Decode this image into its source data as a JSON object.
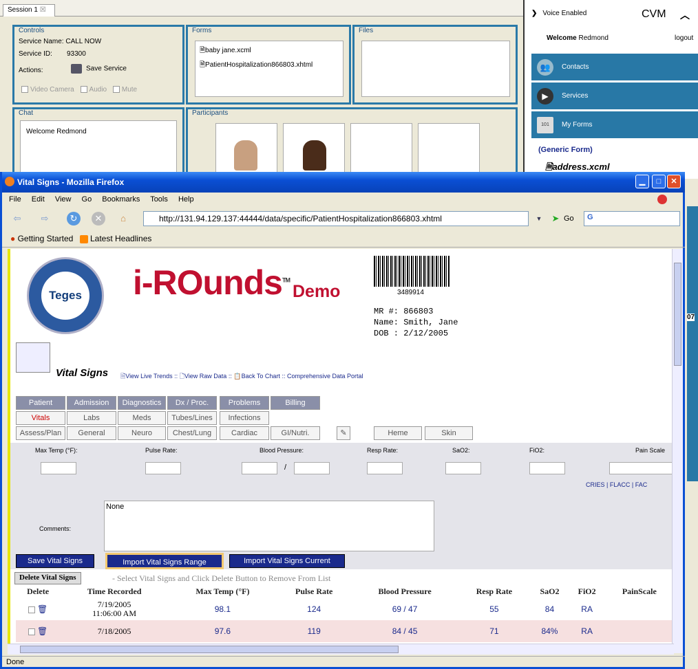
{
  "session": {
    "tab": "Session 1",
    "controls_title": "Controls",
    "service_name": "Service Name:  CALL NOW",
    "service_id_label": "Service ID:",
    "service_id": "93300",
    "actions_label": "Actions:",
    "save_service": "Save Service",
    "video_camera": "Video Camera",
    "audio": "Audio",
    "mute": "Mute",
    "forms_title": "Forms",
    "forms": [
      "baby jane.xcml",
      "PatientHospitalization866803.xhtml"
    ],
    "files_title": "Files",
    "chat_title": "Chat",
    "chat_text": "Welcome Redmond",
    "participants_title": "Participants"
  },
  "right": {
    "voice": "Voice Enabled",
    "cvm": "CVM",
    "welcome": "Welcome",
    "user": "Redmond",
    "logout": "logout",
    "contacts": "Contacts",
    "services": "Services",
    "myforms": "My Forms",
    "generic": "(Generic Form)",
    "address": "address.xcml",
    "num": "07"
  },
  "browser": {
    "title": "Vital Signs - Mozilla Firefox",
    "menu": [
      "File",
      "Edit",
      "View",
      "Go",
      "Bookmarks",
      "Tools",
      "Help"
    ],
    "url": "http://131.94.129.137:44444/data/specific/PatientHospitalization866803.xhtml",
    "go": "Go",
    "bm1": "Getting Started",
    "bm2": "Latest Headlines",
    "status": "Done"
  },
  "page": {
    "logo": "Teges",
    "brand": "i-ROunds",
    "tm": "TM",
    "demo": "Demo",
    "barcode": "3489914",
    "mr": "MR #: 866803",
    "name": "Name: Smith, Jane",
    "dob": "DOB : 2/12/2005",
    "heading": "Vital Signs",
    "link_trends": "View Live Trends",
    "link_raw": "View Raw Data",
    "link_chart": "Back To Chart",
    "link_portal": "Comprehensive Data Portal",
    "sep1": "::",
    "sep2": "::",
    "sep3": "::",
    "tabs1": [
      "Patient",
      "Admission",
      "Diagnostics",
      "Dx / Proc.",
      "Problems",
      "Billing"
    ],
    "tabs2": [
      "Vitals",
      "Labs",
      "Meds",
      "Tubes/Lines",
      "Infections"
    ],
    "tabs3": [
      "Assess/Plan",
      "General",
      "Neuro",
      "Chest/Lung",
      "Cardiac",
      "GI/Nutri.",
      "Heme",
      "Skin"
    ],
    "fields": [
      "Max Temp (°F):",
      "Pulse Rate:",
      "Blood Pressure:",
      "Resp Rate:",
      "SaO2:",
      "FiO2:",
      "Pain Scale"
    ],
    "bp_sep": "/",
    "scales": "CRIES |  FLACC |  FAC",
    "comments_label": "Comments:",
    "comments": "None",
    "btn_save": "Save Vital Signs",
    "btn_range": "Import Vital Signs Range",
    "btn_current": "Import Vital Signs Current",
    "btn_delete": "Delete Vital Signs",
    "delete_hint": "- Select Vital Signs and Click Delete Button to Remove From List",
    "cols": [
      "Delete",
      "Time Recorded",
      "Max Temp (°F)",
      "Pulse Rate",
      "Blood Pressure",
      "Resp Rate",
      "SaO2",
      "FiO2",
      "PainScale"
    ],
    "rows": [
      {
        "date": "7/19/2005",
        "time": "11:06:00 AM",
        "temp": "98.1",
        "pulse": "124",
        "bp": "69 / 47",
        "resp": "55",
        "sao2": "84",
        "fio2": "RA"
      },
      {
        "date": "7/18/2005",
        "time": "",
        "temp": "97.6",
        "pulse": "119",
        "bp": "84 / 45",
        "resp": "71",
        "sao2": "84%",
        "fio2": "RA"
      }
    ]
  }
}
